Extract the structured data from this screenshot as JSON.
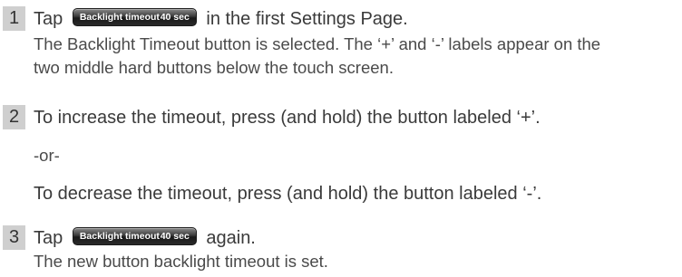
{
  "steps": [
    {
      "number": "1",
      "before": "Tap",
      "button": {
        "label": "Backlight timeout",
        "value": "40 sec"
      },
      "after": "in the first Settings Page.",
      "detail_lines": [
        "The Backlight Timeout button is selected. The ‘+’ and ‘-’ labels appear on the",
        "two middle hard buttons below the touch screen."
      ]
    },
    {
      "number": "2",
      "text": "To increase the timeout, press (and hold) the button labeled ‘+’.",
      "or_text": "-or-",
      "alt_text": "To decrease the timeout, press (and hold) the button labeled ‘-’."
    },
    {
      "number": "3",
      "before": "Tap",
      "button": {
        "label": "Backlight timeout",
        "value": "40 sec"
      },
      "after": "again.",
      "detail_lines": [
        "The new button backlight timeout is set."
      ]
    }
  ]
}
